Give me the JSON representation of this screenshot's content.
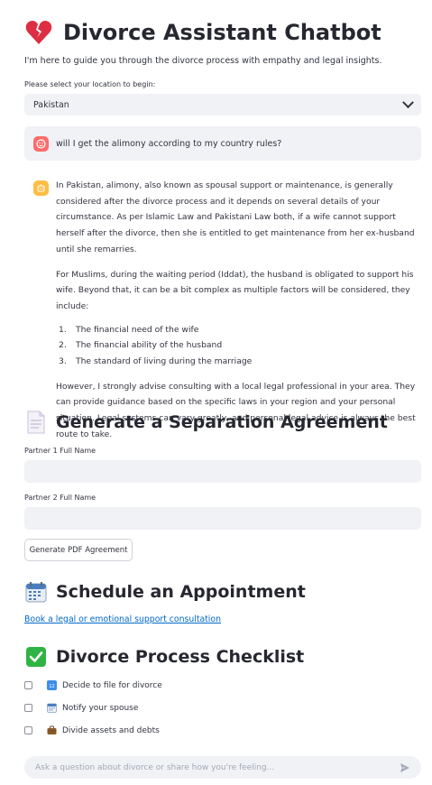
{
  "header": {
    "icon": "broken-heart-icon",
    "title": "Divorce Assistant Chatbot"
  },
  "intro": "I'm here to guide you through the divorce process with empathy and legal insights.",
  "location": {
    "label": "Please select your location to begin:",
    "selected": "Pakistan"
  },
  "chat": {
    "user_message": "will I get the alimony according to my country rules?",
    "assistant": {
      "para1": "In Pakistan, alimony, also known as spousal support or maintenance, is generally considered after the divorce process and it depends on several details of your circumstance. As per Islamic Law and Pakistani Law both, if a wife cannot support herself after the divorce, then she is entitled to get maintenance from her ex-husband until she remarries.",
      "para2": "For Muslims, during the waiting period (Iddat), the husband is obligated to support his wife. Beyond that, it can be a bit complex as multiple factors will be considered, they include:",
      "list": [
        "The financial need of the wife",
        "The financial ability of the husband",
        "The standard of living during the marriage"
      ],
      "para3": "However, I strongly advise consulting with a local legal professional in your area. They can provide guidance based on the specific laws in your region and your personal situation. Legal systems can vary greatly, and personal legal advice is always the best route to take."
    }
  },
  "agreement": {
    "title": "Generate a Separation Agreement",
    "partner1_label": "Partner 1 Full Name",
    "partner1_value": "",
    "partner2_label": "Partner 2 Full Name",
    "partner2_value": "",
    "button_label": "Generate PDF Agreement"
  },
  "appointment": {
    "title": "Schedule an Appointment",
    "link": "Book a legal or emotional support consultation"
  },
  "checklist": {
    "title": "Divorce Process Checklist",
    "items": [
      {
        "label": "Decide to file for divorce",
        "icon": "numbers-icon"
      },
      {
        "label": "Notify your spouse",
        "icon": "calendar-icon"
      },
      {
        "label": "Divide assets and debts",
        "icon": "briefcase-icon"
      }
    ]
  },
  "chat_input": {
    "placeholder": "Ask a question about divorce or share how you're feeling..."
  }
}
